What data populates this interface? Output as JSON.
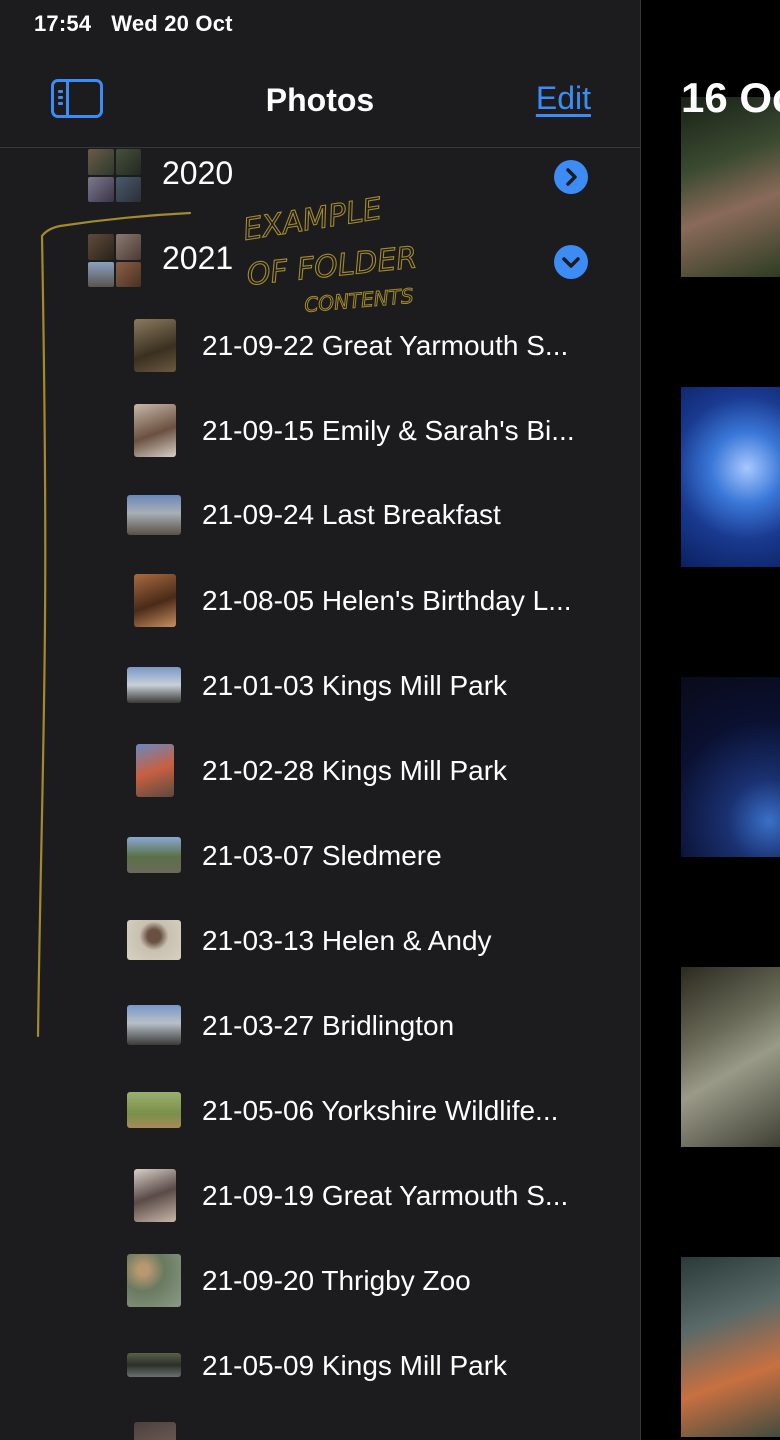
{
  "status_bar": {
    "time": "17:54",
    "date": "Wed 20 Oct"
  },
  "nav": {
    "title": "Photos",
    "edit_label": "Edit"
  },
  "years": [
    {
      "label": "2020",
      "expanded": false,
      "chevron_icon": "chevron-right-icon"
    },
    {
      "label": "2021",
      "expanded": true,
      "chevron_icon": "chevron-down-icon"
    }
  ],
  "albums": [
    {
      "label": "21-09-22 Great Yarmouth S..."
    },
    {
      "label": "21-09-15 Emily & Sarah's Bi..."
    },
    {
      "label": "21-09-24 Last Breakfast"
    },
    {
      "label": "21-08-05 Helen's Birthday L..."
    },
    {
      "label": "21-01-03 Kings Mill Park"
    },
    {
      "label": "21-02-28 Kings Mill Park"
    },
    {
      "label": "21-03-07 Sledmere"
    },
    {
      "label": "21-03-13 Helen & Andy"
    },
    {
      "label": "21-03-27 Bridlington"
    },
    {
      "label": "21-05-06 Yorkshire Wildlife..."
    },
    {
      "label": "21-09-19 Great Yarmouth S..."
    },
    {
      "label": "21-09-20 Thrigby Zoo"
    },
    {
      "label": "21-05-09 Kings Mill Park"
    }
  ],
  "annotation": {
    "line1": "EXAMPLE",
    "line2": "OF FOLDER",
    "line3": "CONTENTS",
    "color": "#a28a2e"
  },
  "main": {
    "heading": "16 Oc"
  },
  "colors": {
    "accent": "#3d8cf6",
    "sidebar_bg": "#1c1c1e",
    "separator": "#38383a"
  }
}
